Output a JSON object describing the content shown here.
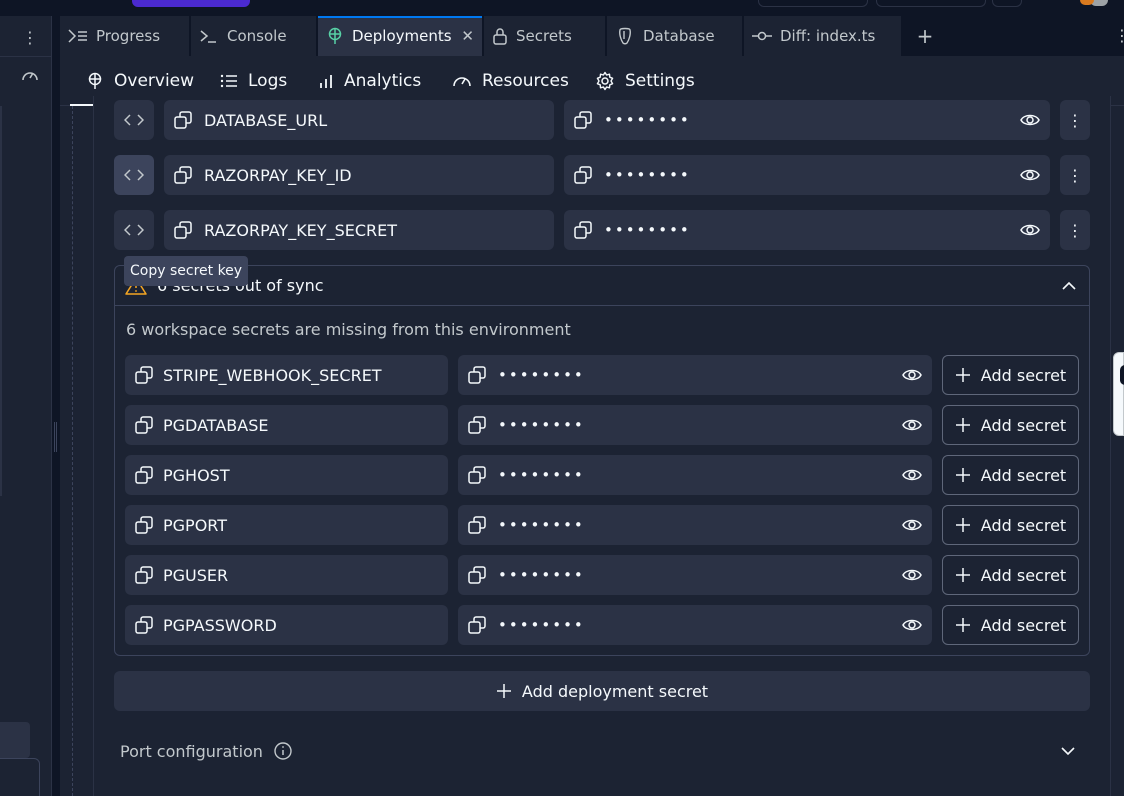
{
  "tabs": [
    {
      "label": "Progress",
      "icon": "progress-icon"
    },
    {
      "label": "Console",
      "icon": "console-icon"
    },
    {
      "label": "Deployments",
      "icon": "deployments-icon",
      "active": true
    },
    {
      "label": "Secrets",
      "icon": "lock-icon"
    },
    {
      "label": "Database",
      "icon": "database-icon"
    },
    {
      "label": "Diff: index.ts",
      "icon": "commit-icon"
    }
  ],
  "subnav": [
    {
      "label": "Overview",
      "icon": "deployments-icon",
      "active": true
    },
    {
      "label": "Logs",
      "icon": "list-icon"
    },
    {
      "label": "Analytics",
      "icon": "bar-chart-icon"
    },
    {
      "label": "Resources",
      "icon": "gauge-icon"
    },
    {
      "label": "Settings",
      "icon": "gear-icon"
    }
  ],
  "deployment_secrets": [
    {
      "key": "DATABASE_URL",
      "value": "••••••••"
    },
    {
      "key": "RAZORPAY_KEY_ID",
      "value": "••••••••"
    },
    {
      "key": "RAZORPAY_KEY_SECRET",
      "value": "••••••••"
    }
  ],
  "tooltip": "Copy secret key",
  "sync": {
    "title": "6 secrets out of sync",
    "description": "6 workspace secrets are missing from this environment",
    "add_label": "Add secret",
    "items": [
      {
        "key": "STRIPE_WEBHOOK_SECRET",
        "value": "••••••••"
      },
      {
        "key": "PGDATABASE",
        "value": "••••••••"
      },
      {
        "key": "PGHOST",
        "value": "••••••••"
      },
      {
        "key": "PGPORT",
        "value": "••••••••"
      },
      {
        "key": "PGUSER",
        "value": "••••••••"
      },
      {
        "key": "PGPASSWORD",
        "value": "••••••••"
      }
    ]
  },
  "add_deployment_secret": "Add deployment secret",
  "port_configuration": "Port configuration",
  "colors": {
    "background": "#1c2333",
    "surface": "#2b3245",
    "accent": "#0079f2",
    "warning": "#f5a623",
    "deployments_icon": "#58d1a6"
  }
}
